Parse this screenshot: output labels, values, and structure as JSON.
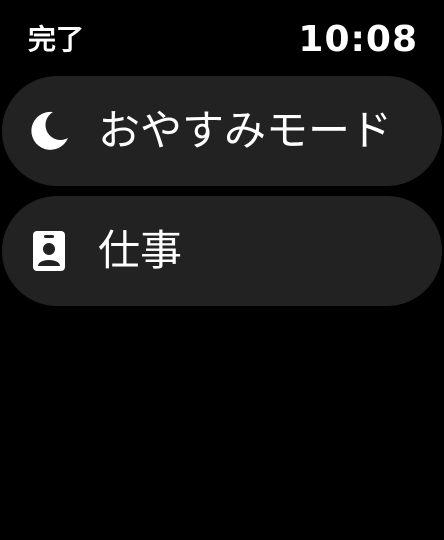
{
  "status_bar": {
    "done_label": "完了",
    "time": "10:08"
  },
  "focus_modes": [
    {
      "label": "おやすみモード",
      "icon": "moon-icon"
    },
    {
      "label": "仕事",
      "icon": "id-badge-icon"
    }
  ],
  "colors": {
    "background": "#000000",
    "item_background": "#222222",
    "text": "#ffffff"
  }
}
